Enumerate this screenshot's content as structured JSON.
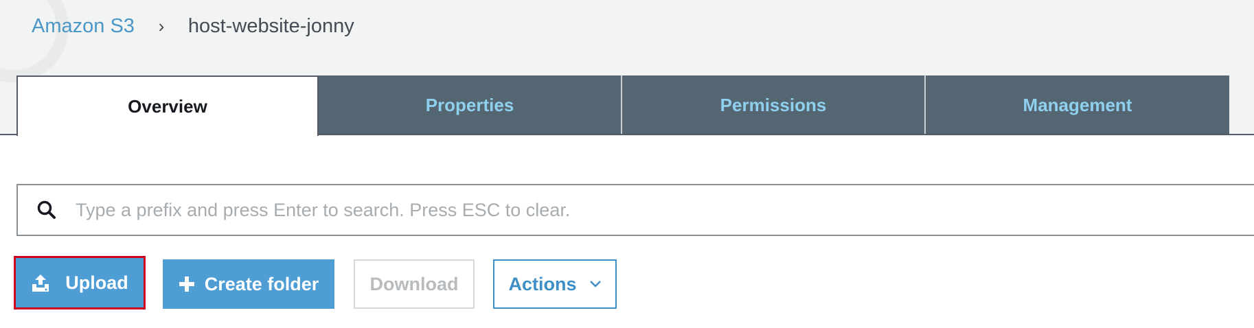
{
  "breadcrumb": {
    "root": "Amazon S3",
    "separator": "›",
    "current": "host-website-jonny"
  },
  "tabs": [
    {
      "label": "Overview",
      "active": true
    },
    {
      "label": "Properties",
      "active": false
    },
    {
      "label": "Permissions",
      "active": false
    },
    {
      "label": "Management",
      "active": false
    }
  ],
  "search": {
    "placeholder": "Type a prefix and press Enter to search. Press ESC to clear.",
    "value": "",
    "icon": "search-icon"
  },
  "toolbar": {
    "upload_label": "Upload",
    "upload_icon": "upload-icon",
    "create_folder_label": "Create folder",
    "create_folder_icon": "plus-icon",
    "download_label": "Download",
    "actions_label": "Actions",
    "actions_icon": "chevron-down-icon"
  },
  "colors": {
    "primary_button": "#4e9dd4",
    "tab_inactive_bg": "#556673",
    "tab_inactive_text": "#8fd0ee",
    "link": "#4a96c7",
    "highlight_border": "#d0021b"
  }
}
